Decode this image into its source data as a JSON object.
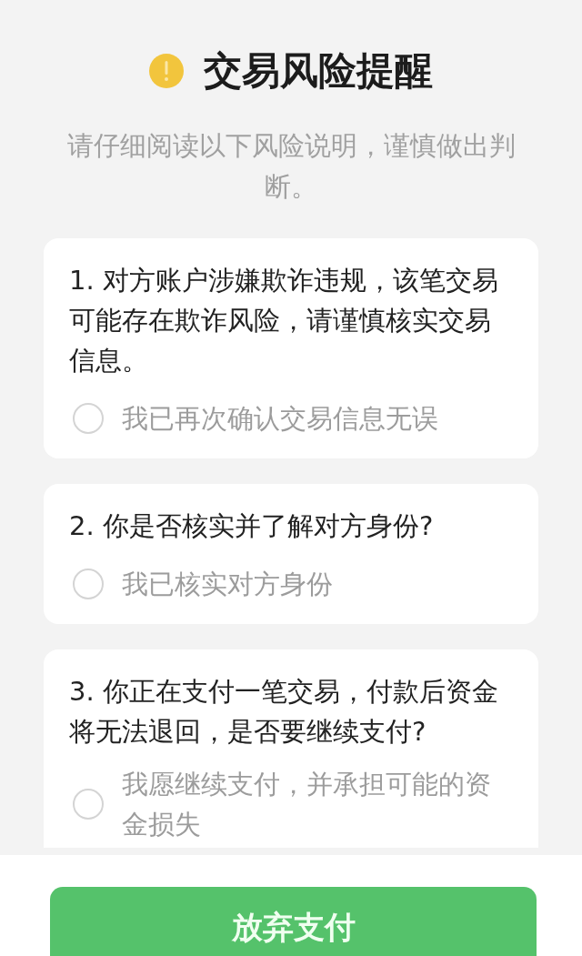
{
  "dialog": {
    "title": "交易风险提醒",
    "subtitle": "请仔细阅读以下风险说明，谨慎做出判断。"
  },
  "questions": [
    {
      "text": "1. 对方账户涉嫌欺诈违规，该笔交易可能存在欺诈风险，请谨慎核实交易信息。",
      "option": {
        "label": "我已再次确认交易信息无误",
        "checked": false
      }
    },
    {
      "text": "2. 你是否核实并了解对方身份?",
      "option": {
        "label": "我已核实对方身份",
        "checked": false
      }
    },
    {
      "text": "3. 你正在支付一笔交易，付款后资金将无法退回，是否要继续支付?",
      "option": {
        "label": "我愿继续支付，并承担可能的资金损失",
        "checked": false
      }
    }
  ],
  "button": {
    "label": "放弃支付"
  }
}
